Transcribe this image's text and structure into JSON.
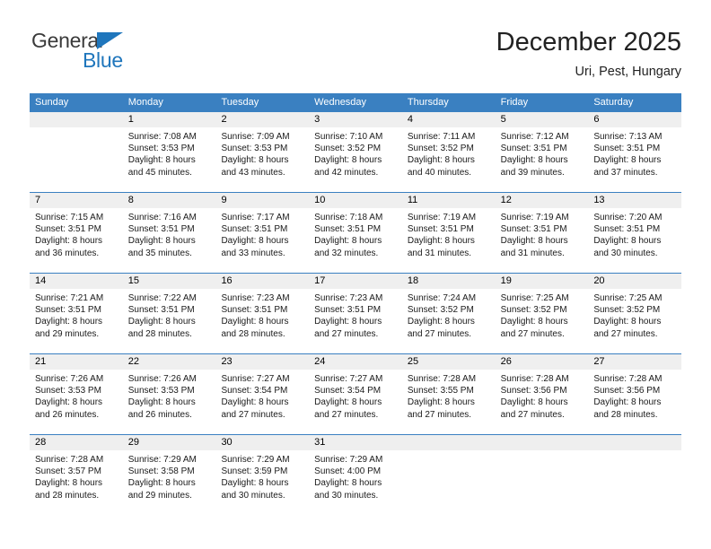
{
  "logo": {
    "word_one": "General",
    "word_two": "Blue",
    "triangle_icon": "triangle-icon",
    "brand_color": "#1f76bc"
  },
  "header": {
    "title": "December 2025",
    "subtitle": "Uri, Pest, Hungary"
  },
  "calendar": {
    "header_bg": "#3a80c1",
    "daynum_bg": "#efefef",
    "weekdays": [
      "Sunday",
      "Monday",
      "Tuesday",
      "Wednesday",
      "Thursday",
      "Friday",
      "Saturday"
    ],
    "labels": {
      "sunrise": "Sunrise:",
      "sunset": "Sunset:",
      "daylight": "Daylight:"
    },
    "weeks": [
      [
        {
          "day": "",
          "empty": true
        },
        {
          "day": "1",
          "sunrise": "Sunrise: 7:08 AM",
          "sunset": "Sunset: 3:53 PM",
          "daylight": "Daylight: 8 hours and 45 minutes."
        },
        {
          "day": "2",
          "sunrise": "Sunrise: 7:09 AM",
          "sunset": "Sunset: 3:53 PM",
          "daylight": "Daylight: 8 hours and 43 minutes."
        },
        {
          "day": "3",
          "sunrise": "Sunrise: 7:10 AM",
          "sunset": "Sunset: 3:52 PM",
          "daylight": "Daylight: 8 hours and 42 minutes."
        },
        {
          "day": "4",
          "sunrise": "Sunrise: 7:11 AM",
          "sunset": "Sunset: 3:52 PM",
          "daylight": "Daylight: 8 hours and 40 minutes."
        },
        {
          "day": "5",
          "sunrise": "Sunrise: 7:12 AM",
          "sunset": "Sunset: 3:51 PM",
          "daylight": "Daylight: 8 hours and 39 minutes."
        },
        {
          "day": "6",
          "sunrise": "Sunrise: 7:13 AM",
          "sunset": "Sunset: 3:51 PM",
          "daylight": "Daylight: 8 hours and 37 minutes."
        }
      ],
      [
        {
          "day": "7",
          "sunrise": "Sunrise: 7:15 AM",
          "sunset": "Sunset: 3:51 PM",
          "daylight": "Daylight: 8 hours and 36 minutes."
        },
        {
          "day": "8",
          "sunrise": "Sunrise: 7:16 AM",
          "sunset": "Sunset: 3:51 PM",
          "daylight": "Daylight: 8 hours and 35 minutes."
        },
        {
          "day": "9",
          "sunrise": "Sunrise: 7:17 AM",
          "sunset": "Sunset: 3:51 PM",
          "daylight": "Daylight: 8 hours and 33 minutes."
        },
        {
          "day": "10",
          "sunrise": "Sunrise: 7:18 AM",
          "sunset": "Sunset: 3:51 PM",
          "daylight": "Daylight: 8 hours and 32 minutes."
        },
        {
          "day": "11",
          "sunrise": "Sunrise: 7:19 AM",
          "sunset": "Sunset: 3:51 PM",
          "daylight": "Daylight: 8 hours and 31 minutes."
        },
        {
          "day": "12",
          "sunrise": "Sunrise: 7:19 AM",
          "sunset": "Sunset: 3:51 PM",
          "daylight": "Daylight: 8 hours and 31 minutes."
        },
        {
          "day": "13",
          "sunrise": "Sunrise: 7:20 AM",
          "sunset": "Sunset: 3:51 PM",
          "daylight": "Daylight: 8 hours and 30 minutes."
        }
      ],
      [
        {
          "day": "14",
          "sunrise": "Sunrise: 7:21 AM",
          "sunset": "Sunset: 3:51 PM",
          "daylight": "Daylight: 8 hours and 29 minutes."
        },
        {
          "day": "15",
          "sunrise": "Sunrise: 7:22 AM",
          "sunset": "Sunset: 3:51 PM",
          "daylight": "Daylight: 8 hours and 28 minutes."
        },
        {
          "day": "16",
          "sunrise": "Sunrise: 7:23 AM",
          "sunset": "Sunset: 3:51 PM",
          "daylight": "Daylight: 8 hours and 28 minutes."
        },
        {
          "day": "17",
          "sunrise": "Sunrise: 7:23 AM",
          "sunset": "Sunset: 3:51 PM",
          "daylight": "Daylight: 8 hours and 27 minutes."
        },
        {
          "day": "18",
          "sunrise": "Sunrise: 7:24 AM",
          "sunset": "Sunset: 3:52 PM",
          "daylight": "Daylight: 8 hours and 27 minutes."
        },
        {
          "day": "19",
          "sunrise": "Sunrise: 7:25 AM",
          "sunset": "Sunset: 3:52 PM",
          "daylight": "Daylight: 8 hours and 27 minutes."
        },
        {
          "day": "20",
          "sunrise": "Sunrise: 7:25 AM",
          "sunset": "Sunset: 3:52 PM",
          "daylight": "Daylight: 8 hours and 27 minutes."
        }
      ],
      [
        {
          "day": "21",
          "sunrise": "Sunrise: 7:26 AM",
          "sunset": "Sunset: 3:53 PM",
          "daylight": "Daylight: 8 hours and 26 minutes."
        },
        {
          "day": "22",
          "sunrise": "Sunrise: 7:26 AM",
          "sunset": "Sunset: 3:53 PM",
          "daylight": "Daylight: 8 hours and 26 minutes."
        },
        {
          "day": "23",
          "sunrise": "Sunrise: 7:27 AM",
          "sunset": "Sunset: 3:54 PM",
          "daylight": "Daylight: 8 hours and 27 minutes."
        },
        {
          "day": "24",
          "sunrise": "Sunrise: 7:27 AM",
          "sunset": "Sunset: 3:54 PM",
          "daylight": "Daylight: 8 hours and 27 minutes."
        },
        {
          "day": "25",
          "sunrise": "Sunrise: 7:28 AM",
          "sunset": "Sunset: 3:55 PM",
          "daylight": "Daylight: 8 hours and 27 minutes."
        },
        {
          "day": "26",
          "sunrise": "Sunrise: 7:28 AM",
          "sunset": "Sunset: 3:56 PM",
          "daylight": "Daylight: 8 hours and 27 minutes."
        },
        {
          "day": "27",
          "sunrise": "Sunrise: 7:28 AM",
          "sunset": "Sunset: 3:56 PM",
          "daylight": "Daylight: 8 hours and 28 minutes."
        }
      ],
      [
        {
          "day": "28",
          "sunrise": "Sunrise: 7:28 AM",
          "sunset": "Sunset: 3:57 PM",
          "daylight": "Daylight: 8 hours and 28 minutes."
        },
        {
          "day": "29",
          "sunrise": "Sunrise: 7:29 AM",
          "sunset": "Sunset: 3:58 PM",
          "daylight": "Daylight: 8 hours and 29 minutes."
        },
        {
          "day": "30",
          "sunrise": "Sunrise: 7:29 AM",
          "sunset": "Sunset: 3:59 PM",
          "daylight": "Daylight: 8 hours and 30 minutes."
        },
        {
          "day": "31",
          "sunrise": "Sunrise: 7:29 AM",
          "sunset": "Sunset: 4:00 PM",
          "daylight": "Daylight: 8 hours and 30 minutes."
        },
        {
          "day": "",
          "blank": true
        },
        {
          "day": "",
          "blank": true
        },
        {
          "day": "",
          "blank": true
        }
      ]
    ]
  }
}
